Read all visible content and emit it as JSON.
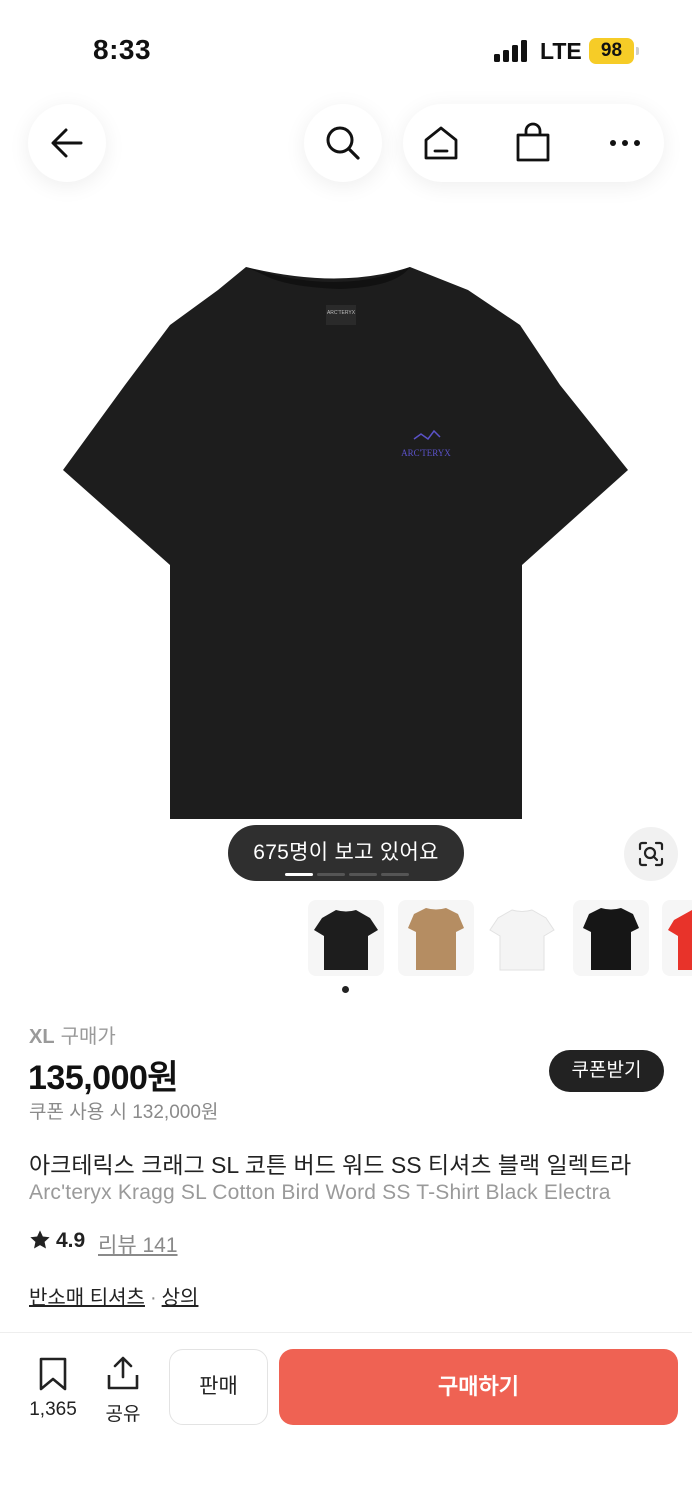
{
  "status_bar": {
    "time": "8:33",
    "network": "LTE",
    "battery": "98"
  },
  "colors": {
    "buy_button": "#ef6253",
    "battery": "#f6cc27",
    "dark_pill": "#2f2f2f",
    "logo_purple": "#5b52c8"
  },
  "icons": {
    "back": "arrow-left-icon",
    "search": "search-icon",
    "home": "home-icon",
    "cart": "shopping-bag-icon",
    "more": "more-horizontal-icon",
    "lens": "image-search-icon",
    "star": "star-icon",
    "bookmark": "bookmark-icon",
    "share": "share-icon"
  },
  "product_image": {
    "brand_print": "ARC'TERYX",
    "neck_label": "ARC'TERYX"
  },
  "gallery": {
    "viewers_text": "675명이 보고 있어요",
    "page_count": 4,
    "current_page": 1
  },
  "thumbnails": [
    {
      "color": "black"
    },
    {
      "color": "tan"
    },
    {
      "color": "white"
    },
    {
      "color": "black"
    },
    {
      "color": "red"
    }
  ],
  "product": {
    "size": "XL",
    "size_suffix": "구매가",
    "price": "135,000원",
    "coupon_button": "쿠폰받기",
    "coupon_price": "쿠폰 사용 시 132,000원",
    "title_ko": "아크테릭스 크래그 SL 코튼 버드 워드 SS 티셔츠 블랙 일렉트라",
    "title_en": "Arc'teryx Kragg SL Cotton Bird Word SS T-Shirt Black Electra",
    "rating": "4.9",
    "reviews": "리뷰 141",
    "category_1": "반소매 티셔츠",
    "category_sep": "·",
    "category_2": "상의"
  },
  "bottom_bar": {
    "bookmark_count": "1,365",
    "share_label": "공유",
    "sell_label": "판매",
    "buy_label": "구매하기"
  }
}
